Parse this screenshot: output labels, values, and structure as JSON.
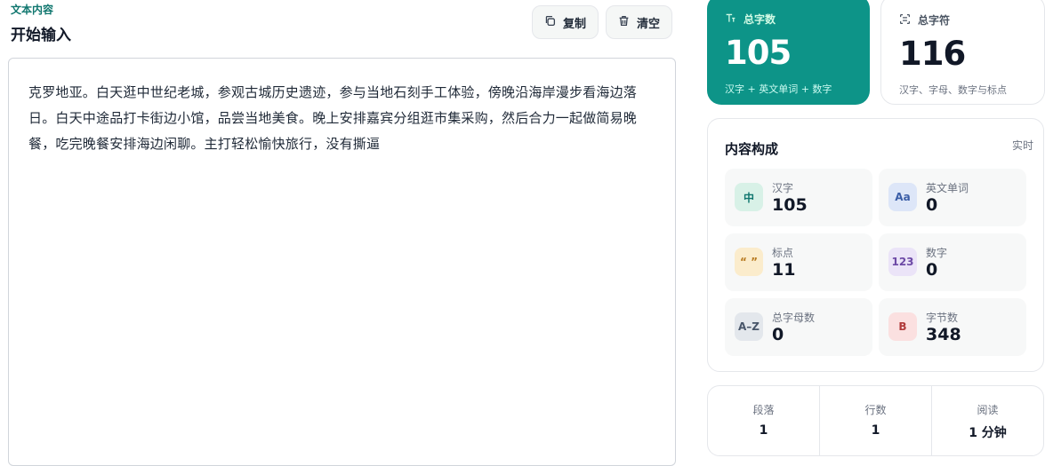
{
  "editor": {
    "kicker": "文本内容",
    "title": "开始输入",
    "copy_label": "复制",
    "clear_label": "清空",
    "content": "克罗地亚。白天逛中世纪老城，参观古城历史遗迹，参与当地石刻手工体验，傍晚沿海岸漫步看海边落日。白天中途品打卡街边小馆，品尝当地美食。晚上安排嘉宾分组逛市集采购，然后合力一起做简易晚餐，吃完晚餐安排海边闲聊。主打轻松愉快旅行，没有撕逼"
  },
  "totals": {
    "words": {
      "label": "总字数",
      "value": "105",
      "sub": "汉字 + 英文单词 + 数字",
      "icon": "text-size-icon"
    },
    "chars": {
      "label": "总字符",
      "value": "116",
      "sub": "汉字、字母、数字与标点",
      "icon": "scan-text-icon"
    }
  },
  "composition": {
    "title": "内容构成",
    "live": "实时",
    "items": [
      {
        "icon_text": "中",
        "label": "汉字",
        "value": "105",
        "icon": "chinese-char-icon"
      },
      {
        "icon_text": "Aa",
        "label": "英文单词",
        "value": "0",
        "icon": "english-word-icon"
      },
      {
        "icon_text": "“ ”",
        "label": "标点",
        "value": "11",
        "icon": "quote-icon"
      },
      {
        "icon_text": "123",
        "label": "数字",
        "value": "0",
        "icon": "number-icon"
      },
      {
        "icon_text": "A–Z",
        "label": "总字母数",
        "value": "0",
        "icon": "letters-icon"
      },
      {
        "icon_text": "B",
        "label": "字节数",
        "value": "348",
        "icon": "bytes-icon"
      }
    ]
  },
  "meta": [
    {
      "label": "段落",
      "value": "1"
    },
    {
      "label": "行数",
      "value": "1"
    },
    {
      "label": "阅读",
      "value": "1 分钟"
    }
  ],
  "colors": {
    "accent": "#0d9488",
    "kicker": "#0f766e"
  }
}
